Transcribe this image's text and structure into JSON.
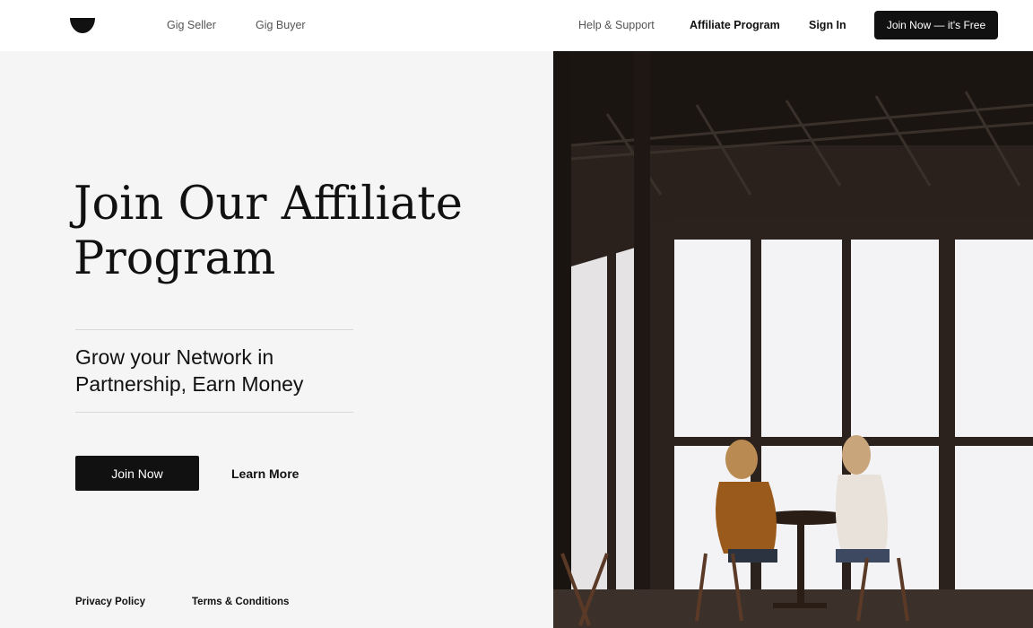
{
  "header": {
    "logo_icon": "smile-logo-icon",
    "nav_left": [
      "Gig Seller",
      "Gig Buyer"
    ],
    "nav_right": {
      "help": "Help & Support",
      "affiliate": "Affiliate Program",
      "sign_in": "Sign In"
    },
    "cta": "Join Now — it's Free"
  },
  "hero": {
    "title": "Join Our Affiliate Program",
    "subtitle": "Grow your Network in Partnership, Earn Money",
    "primary_button": "Join Now",
    "secondary_button": "Learn More"
  },
  "footer": {
    "privacy": "Privacy Policy",
    "terms": "Terms & Conditions"
  },
  "image": {
    "icon": "photo-two-women-cafe-table"
  },
  "colors": {
    "primary": "#111111",
    "background": "#f5f5f5",
    "header_bg": "#ffffff",
    "muted_text": "#555555"
  }
}
